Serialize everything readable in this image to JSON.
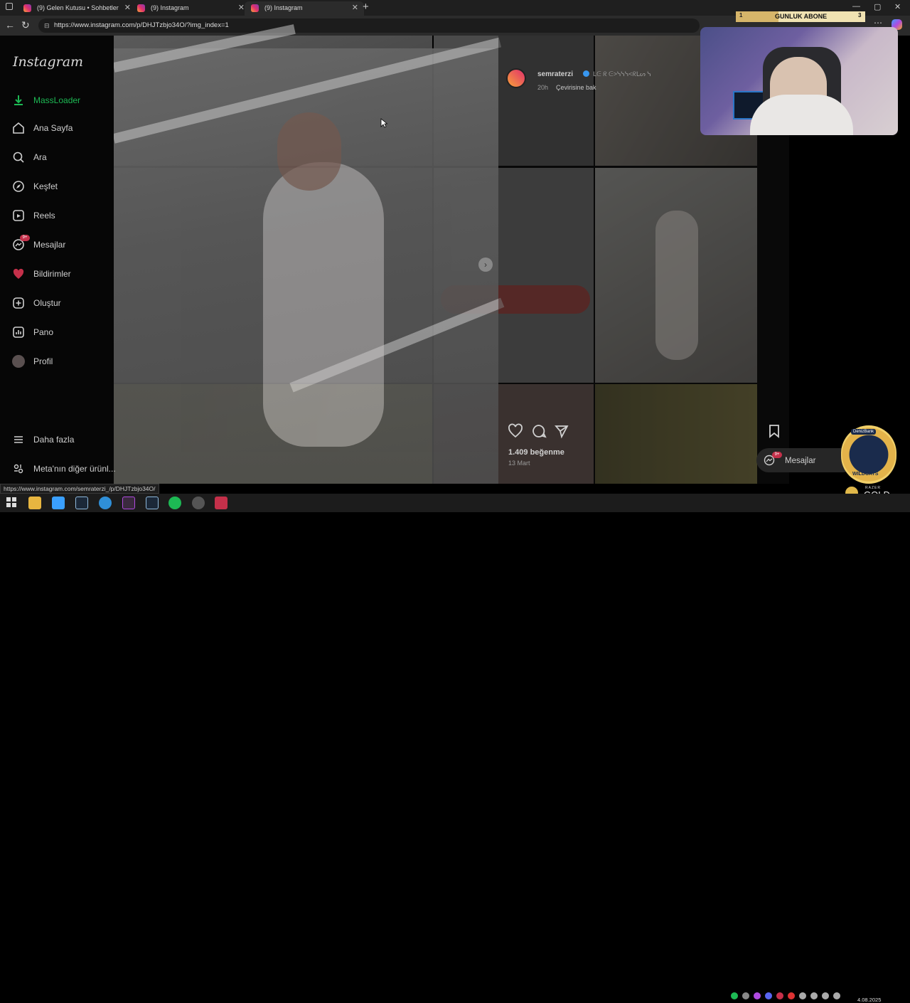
{
  "browser": {
    "tabs": [
      {
        "label": "(9) Gelen Kutusu • Sohbetler"
      },
      {
        "label": "(9) Instagram"
      },
      {
        "label": "(9) Instagram"
      }
    ],
    "url": "https://www.instagram.com/p/DHJTzbjo34O/?img_index=1",
    "status_url": "https://www.instagram.com/semraterzi_/p/DHJTzbjo34O/"
  },
  "sidebar": {
    "logo": "Instagram",
    "items": [
      {
        "label": "MassLoader",
        "icon": "download-icon"
      },
      {
        "label": "Ana Sayfa",
        "icon": "home-icon"
      },
      {
        "label": "Ara",
        "icon": "search-icon"
      },
      {
        "label": "Keşfet",
        "icon": "compass-icon"
      },
      {
        "label": "Reels",
        "icon": "reels-icon"
      },
      {
        "label": "Mesajlar",
        "icon": "messenger-icon",
        "badge": "9+"
      },
      {
        "label": "Bildirimler",
        "icon": "heart-icon"
      },
      {
        "label": "Oluştur",
        "icon": "plus-icon"
      },
      {
        "label": "Pano",
        "icon": "chart-icon"
      },
      {
        "label": "Profil",
        "icon": "avatar-icon"
      }
    ],
    "more_label": "Daha fazla",
    "meta_label": "Meta'nın diğer ürünl..."
  },
  "post": {
    "author": "semraterzi",
    "bio": "ᒪᕮ ᖇ ᕮ>ᓭᓭᓭ<ᖇᒪᔕ ᓭ",
    "time": "20h",
    "translate_label": "Çevirisine bak",
    "likes": "1.409 beğenme",
    "date": "13 Mart"
  },
  "messages_pill": {
    "label": "Mesajlar",
    "badge": "9+"
  },
  "stream_overlay": {
    "sub_current": "1",
    "sub_label": "GUNLUK ABONE",
    "sub_goal": "3",
    "sub_progress": 0.33,
    "sponsor_bank": "DenizBank",
    "sponsor_team": "WILDCATS",
    "razer_small": "RAZER",
    "razer_label": "GOLD"
  },
  "taskbar": {
    "date": "4.08.2025"
  },
  "colors": {
    "massloader": "#1db954",
    "badge": "#c4304a",
    "verified": "#3897f0"
  }
}
